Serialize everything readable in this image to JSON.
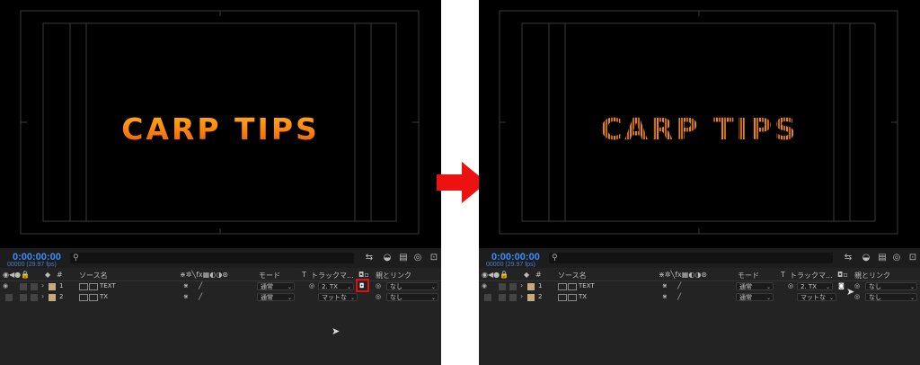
{
  "composition": {
    "title": "CARP TIPS"
  },
  "timeline": {
    "timecode": "0:00:00:00",
    "fps": "00000 (29.97 fps)",
    "headers": {
      "source_name": "ソース名",
      "mode": "モード",
      "t": "T",
      "track_matte": "トラックマ...",
      "parent_link": "親とリンク",
      "hash": "#"
    },
    "layers": [
      {
        "number": "1",
        "name": "TEXT",
        "mode": "通常",
        "matte": "2. TX",
        "parent": "なし"
      },
      {
        "number": "2",
        "name": "TX",
        "mode": "通常",
        "matte": "マットな",
        "parent": "なし"
      }
    ]
  },
  "colors": {
    "accent_timecode": "#3b8cff",
    "highlight": "#e01010",
    "arrow": "#ee1111"
  },
  "icons": [
    "search-icon",
    "arrow-right-icon",
    "cursor-icon",
    "eye-icon",
    "audio-icon",
    "solo-icon",
    "lock-icon",
    "label-icon",
    "twirl-icon",
    "pickwhip-icon"
  ]
}
